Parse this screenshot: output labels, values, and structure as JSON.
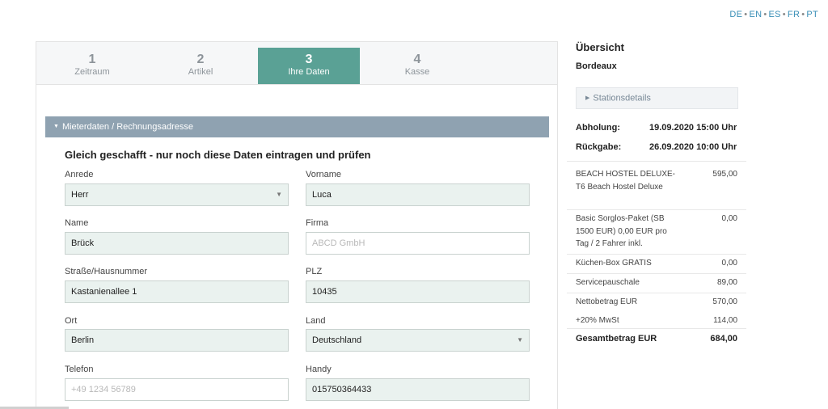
{
  "languages": [
    "DE",
    "EN",
    "ES",
    "FR",
    "PT"
  ],
  "steps": [
    {
      "num": "1",
      "label": "Zeitraum"
    },
    {
      "num": "2",
      "label": "Artikel"
    },
    {
      "num": "3",
      "label": "Ihre Daten"
    },
    {
      "num": "4",
      "label": "Kasse"
    }
  ],
  "section": {
    "title": "Mieterdaten / Rechnungsadresse"
  },
  "form": {
    "title": "Gleich geschafft - nur noch diese Daten eintragen und prüfen",
    "anrede": {
      "label": "Anrede",
      "value": "Herr"
    },
    "vorname": {
      "label": "Vorname",
      "value": "Luca"
    },
    "name": {
      "label": "Name",
      "value": "Brück"
    },
    "firma": {
      "label": "Firma",
      "placeholder": "ABCD GmbH"
    },
    "strasse": {
      "label": "Straße/Hausnummer",
      "value": "Kastanienallee 1"
    },
    "plz": {
      "label": "PLZ",
      "value": "10435"
    },
    "ort": {
      "label": "Ort",
      "value": "Berlin"
    },
    "land": {
      "label": "Land",
      "value": "Deutschland"
    },
    "telefon": {
      "label": "Telefon",
      "placeholder": "+49 1234 56789"
    },
    "handy": {
      "label": "Handy",
      "value": "015750364433"
    }
  },
  "summary": {
    "title": "Übersicht",
    "city": "Bordeaux",
    "stations_label": "Stationsdetails",
    "pickup_label": "Abholung:",
    "pickup_value": "19.09.2020 15:00 Uhr",
    "return_label": "Rückgabe:",
    "return_value": "26.09.2020 10:00 Uhr",
    "items": [
      {
        "name": "BEACH HOSTEL DELUXE-T6 Beach Hostel Deluxe",
        "amount": "595,00"
      },
      {
        "name": "Basic Sorglos-Paket (SB 1500 EUR) 0,00 EUR pro Tag / 2 Fahrer inkl.",
        "amount": "0,00"
      },
      {
        "name": "Küchen-Box GRATIS",
        "amount": "0,00"
      },
      {
        "name": "Servicepauschale",
        "amount": "89,00"
      },
      {
        "name": "Nettobetrag EUR",
        "amount": "570,00"
      },
      {
        "name": "+20% MwSt",
        "amount": "114,00"
      },
      {
        "name": "Gesamtbetrag EUR",
        "amount": "684,00"
      }
    ]
  },
  "icons": {
    "caret_down": "caret-down-icon",
    "caret_right": "caret-right-icon",
    "select_arrow": "chevron-down-icon"
  }
}
